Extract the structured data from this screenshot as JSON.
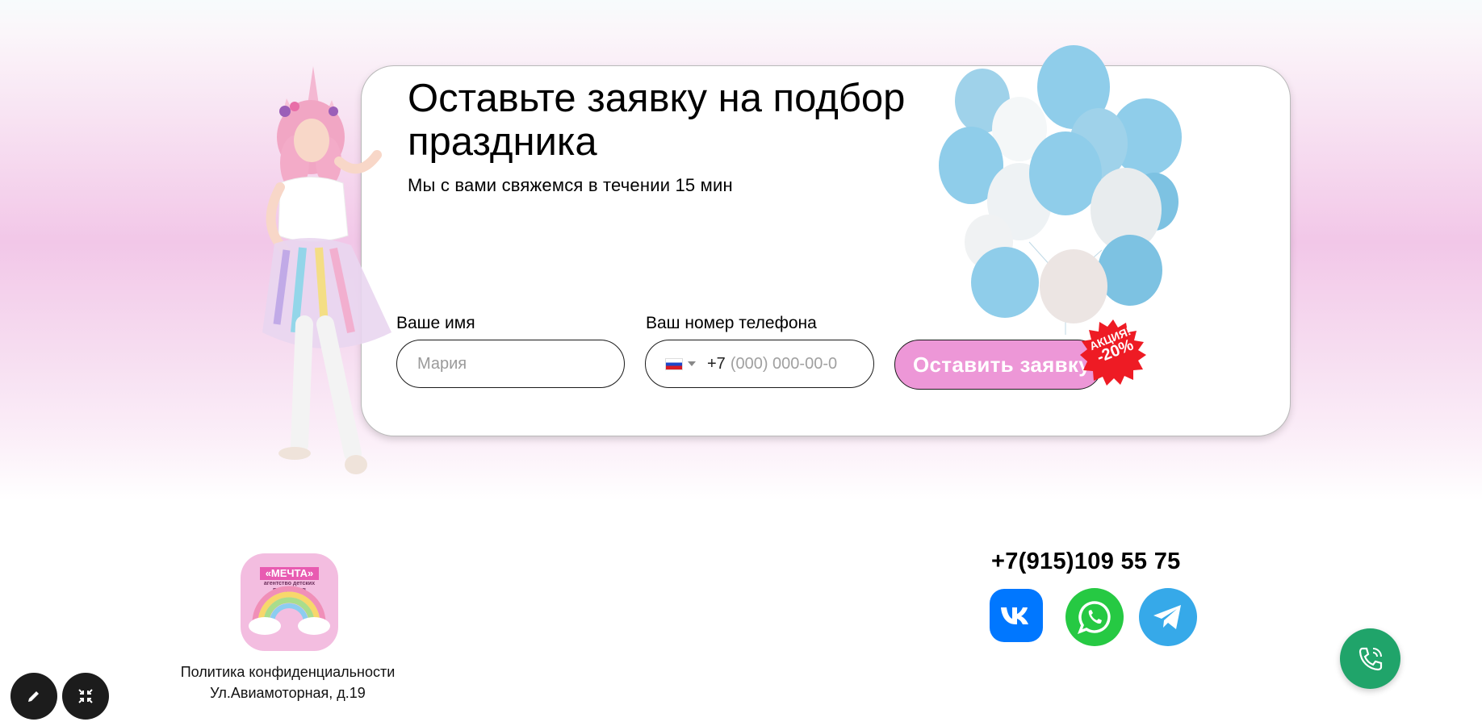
{
  "form": {
    "title": "Оставьте заявку на подбор праздника",
    "subtitle": "Мы с вами свяжемся в течении 15 мин",
    "name_label": "Ваше имя",
    "name_placeholder": "Мария",
    "phone_label": "Ваш номер телефона",
    "phone_prefix": "+7",
    "phone_placeholder": "(000) 000-00-0",
    "submit_label": "Оставить заявку",
    "badge_line1": "АКЦИЯ!",
    "badge_line2": "-20%"
  },
  "footer": {
    "logo_title": "«МЕЧТА»",
    "logo_subtitle": "агентство детских праздников",
    "privacy_link": "Политика конфиденциальности",
    "address": "Ул.Авиамоторная, д.19",
    "phone": "+7(915)109 55 75"
  },
  "colors": {
    "accent_pink": "#ed97d7",
    "vk_blue": "#0077ff",
    "whatsapp_green": "#26c943",
    "telegram_blue": "#36a9e9",
    "call_green": "#20a46a"
  },
  "icons": [
    "russia-flag-icon",
    "vk-icon",
    "whatsapp-icon",
    "telegram-icon",
    "phone-call-icon",
    "pencil-icon",
    "collapse-icon"
  ]
}
